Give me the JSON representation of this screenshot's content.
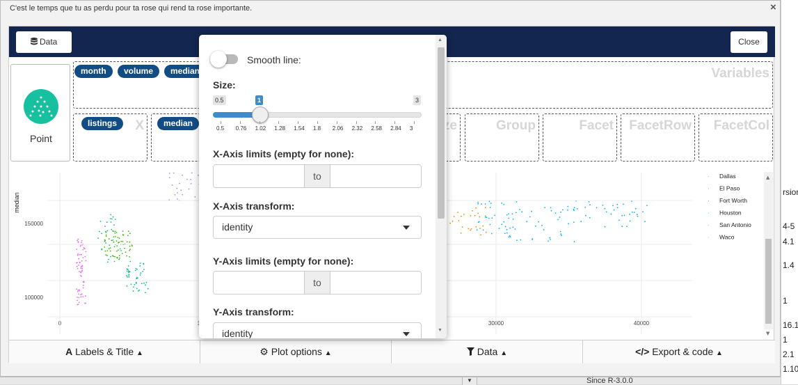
{
  "dialog": {
    "title": "C'est le temps que tu as perdu pour ta rose qui rend ta rose importante.",
    "close_symbol": "×"
  },
  "topbar": {
    "data_button": "Data",
    "close_button": "Close",
    "bg": "#13264f"
  },
  "geom": {
    "label": "Point",
    "color": "#17c19f"
  },
  "dropzones": {
    "variables": {
      "title": "Variables",
      "pills": [
        "month",
        "volume",
        "median"
      ]
    },
    "x": {
      "title": "X",
      "pill": "listings"
    },
    "y": {
      "pill": "median"
    },
    "fill_partial": "ze",
    "group": "Group",
    "facet": "Facet",
    "facet_row": "FacetRow",
    "facet_col": "FacetCol"
  },
  "popover": {
    "smooth_label": "Smooth line:",
    "size_label": "Size:",
    "size_min": "0.5",
    "size_value": "1",
    "size_max": "3",
    "size_grid": [
      "0.5",
      "0.76",
      "1.02",
      "1.28",
      "1.54",
      "1.8",
      "2.06",
      "2.32",
      "2.58",
      "2.84",
      "3"
    ],
    "xlim_label": "X-Axis limits (empty for none):",
    "xlim_to": "to",
    "xtrans_label": "X-Axis transform:",
    "xtrans_value": "identity",
    "ylim_label": "Y-Axis limits (empty for none):",
    "ylim_to": "to",
    "ytrans_label": "Y-Axis transform:",
    "ytrans_value": "identity"
  },
  "tabs": {
    "labels": {
      "icon": "font-icon",
      "label": "Labels & Title"
    },
    "plot": {
      "icon": "gears-icon",
      "label": "Plot options"
    },
    "data": {
      "icon": "filter-icon",
      "label": "Data"
    },
    "export": {
      "icon": "code-icon",
      "label": "Export & code"
    }
  },
  "chart_data": {
    "type": "scatter",
    "ylabel": "median",
    "y_ticks": [
      "100000",
      "150000"
    ],
    "x_ticks": [
      "0",
      "1",
      "30000",
      "40000"
    ],
    "legend": [
      "Dallas",
      "El Paso",
      "Fort Worth",
      "Houston",
      "San Antonio",
      "Waco"
    ],
    "colors": {
      "Dallas": "#a3a500",
      "El Paso": "#39b600",
      "Fort Worth": "#00bf7d",
      "Houston": "#00b0f6",
      "San Antonio": "#e76bf3",
      "Waco": "#f8766d",
      "Austin": "#9590ff",
      "Other": "#d89000"
    }
  },
  "background": {
    "right_cells": [
      "rsion",
      "4-5",
      "4.1",
      "1.4",
      "1",
      "16.1-",
      "1",
      "2.1",
      "1.10"
    ],
    "since": "Since R-3.0.0"
  }
}
